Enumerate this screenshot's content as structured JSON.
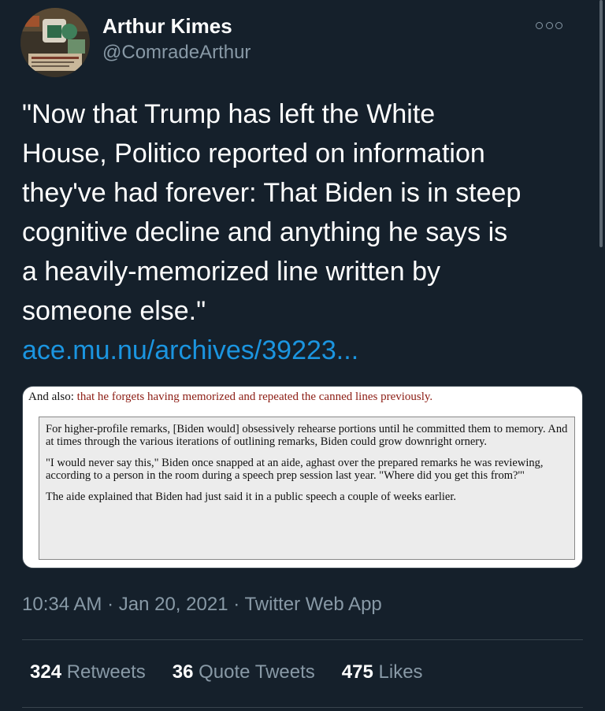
{
  "user": {
    "name": "Arthur Kimes",
    "handle": "@ComradeArthur"
  },
  "tweet": {
    "text": "\"Now that Trump has left the White\nHouse, Politico reported on information\nthey've had forever: That Biden is in steep\ncognitive decline and anything he says is\na heavily-memorized line written by\nsomeone else.\"",
    "link": "ace.mu.nu/archives/39223..."
  },
  "media": {
    "intro_prefix": "And also:",
    "intro_highlight": "that he forgets having memorized and repeated the canned lines previously.",
    "paragraphs": [
      "For higher-profile remarks, [Biden would] obsessively rehearse portions until he committed them to memory. And at times through the various iterations of outlining remarks, Biden could grow downright ornery.",
      "\"I would never say this,\" Biden once snapped at an aide, aghast over the prepared remarks he was reviewing, according to a person in the room during a speech prep session last year. \"Where did you get this from?'\"",
      "The aide explained that Biden had just said it in a public speech a couple of weeks earlier."
    ]
  },
  "meta": {
    "time": "10:34 AM",
    "date": "Jan 20, 2021",
    "source": "Twitter Web App",
    "separator": "·"
  },
  "stats": {
    "retweets_count": "324",
    "retweets_label": "Retweets",
    "quotes_count": "36",
    "quotes_label": "Quote Tweets",
    "likes_count": "475",
    "likes_label": "Likes"
  },
  "colors": {
    "background": "#15202b",
    "secondary_text": "#8899a6",
    "link": "#1b95e0",
    "divider": "#38444d"
  },
  "icons": {
    "more": "more-dots-icon"
  }
}
